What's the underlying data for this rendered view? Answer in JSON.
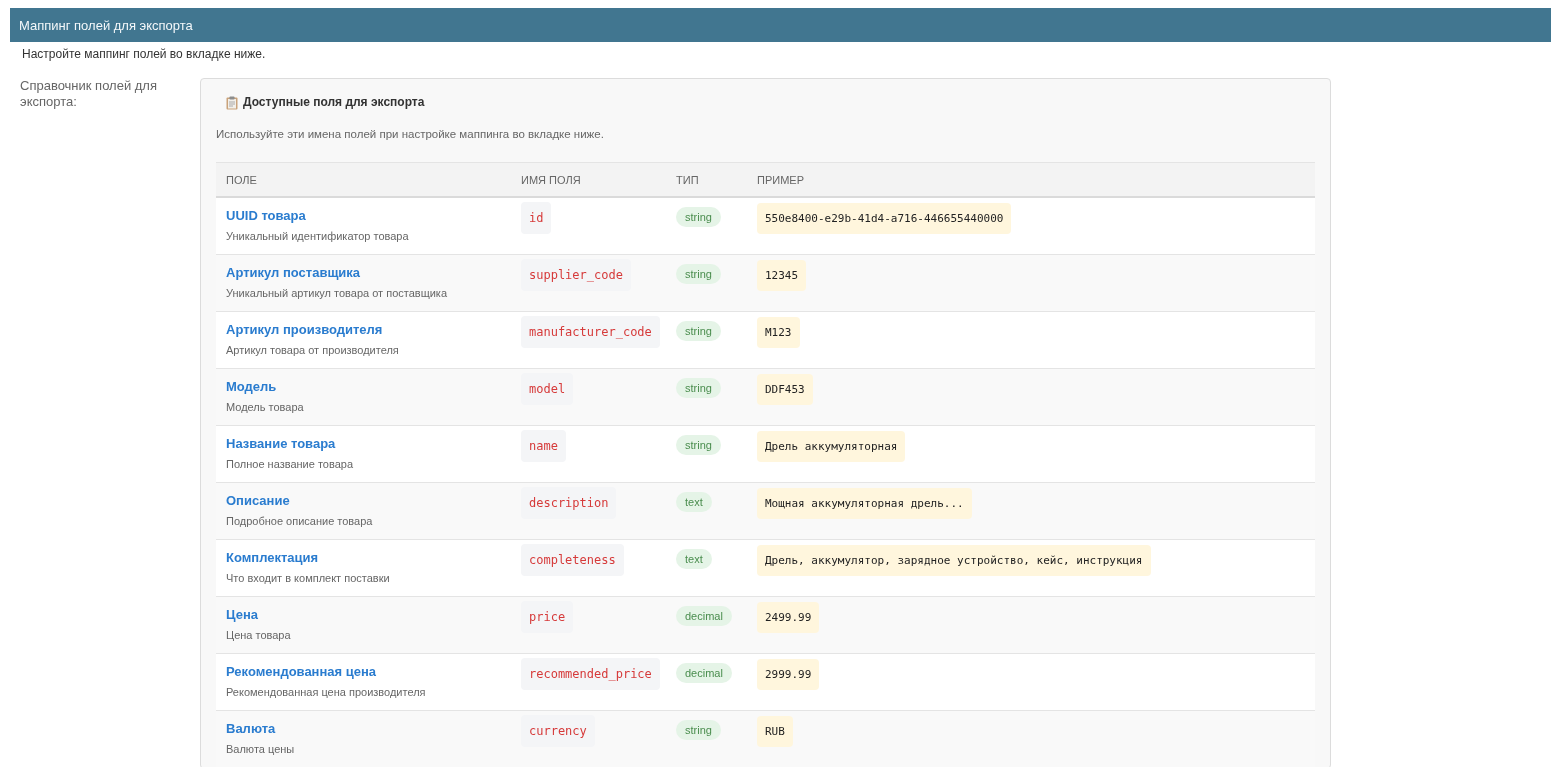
{
  "panel": {
    "title": "Маппинг полей для экспорта"
  },
  "help_text": "Настройте маппинг полей во вкладке ниже.",
  "field": {
    "label": "Справочник полей для экспорта:"
  },
  "reference": {
    "title": "Доступные поля для экспорта",
    "description": "Используйте эти имена полей при настройке маппинга во вкладке ниже.",
    "table": {
      "columns": [
        "ПОЛЕ",
        "ИМЯ ПОЛЯ",
        "ТИП",
        "ПРИМЕР"
      ],
      "rows": [
        {
          "title": "UUID товара",
          "description": "Уникальный идентификатор товара",
          "field_name": "id",
          "type": "string",
          "example": "550e8400-e29b-41d4-a716-446655440000"
        },
        {
          "title": "Артикул поставщика",
          "description": "Уникальный артикул товара от поставщика",
          "field_name": "supplier_code",
          "type": "string",
          "example": "12345"
        },
        {
          "title": "Артикул производителя",
          "description": "Артикул товара от производителя",
          "field_name": "manufacturer_code",
          "type": "string",
          "example": "M123"
        },
        {
          "title": "Модель",
          "description": "Модель товара",
          "field_name": "model",
          "type": "string",
          "example": "DDF453"
        },
        {
          "title": "Название товара",
          "description": "Полное название товара",
          "field_name": "name",
          "type": "string",
          "example": "Дрель аккумуляторная"
        },
        {
          "title": "Описание",
          "description": "Подробное описание товара",
          "field_name": "description",
          "type": "text",
          "example": "Мощная аккумуляторная дрель..."
        },
        {
          "title": "Комплектация",
          "description": "Что входит в комплект поставки",
          "field_name": "completeness",
          "type": "text",
          "example": "Дрель, аккумулятор, зарядное устройство, кейс, инструкция"
        },
        {
          "title": "Цена",
          "description": "Цена товара",
          "field_name": "price",
          "type": "decimal",
          "example": "2499.99"
        },
        {
          "title": "Рекомендованная цена",
          "description": "Рекомендованная цена производителя",
          "field_name": "recommended_price",
          "type": "decimal",
          "example": "2999.99"
        },
        {
          "title": "Валюта",
          "description": "Валюта цены",
          "field_name": "currency",
          "type": "string",
          "example": "RUB"
        }
      ]
    }
  }
}
